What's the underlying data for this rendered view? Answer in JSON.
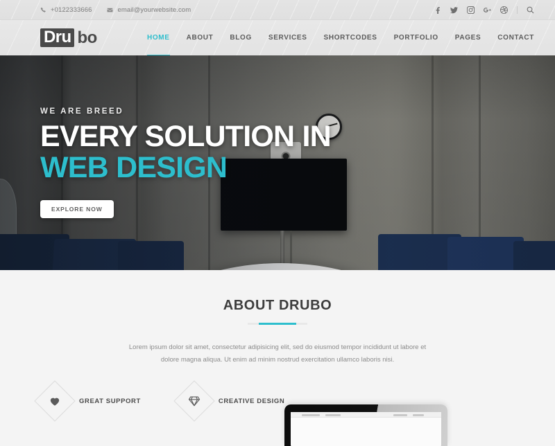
{
  "topbar": {
    "phone": "+0122333666",
    "email": "email@yourwebsite.com",
    "phone_icon": "phone-icon",
    "email_icon": "envelope-icon",
    "social": [
      {
        "name": "facebook-icon",
        "label": "Facebook"
      },
      {
        "name": "twitter-icon",
        "label": "Twitter"
      },
      {
        "name": "instagram-icon",
        "label": "Instagram"
      },
      {
        "name": "google-plus-icon",
        "label": "Google Plus"
      },
      {
        "name": "dribbble-icon",
        "label": "Dribbble"
      }
    ],
    "search_icon": "search-icon"
  },
  "header": {
    "logo_boxed": "Dru",
    "logo_rest": "bo",
    "nav": [
      {
        "label": "HOME",
        "active": true
      },
      {
        "label": "ABOUT",
        "active": false
      },
      {
        "label": "BLOG",
        "active": false
      },
      {
        "label": "SERVICES",
        "active": false
      },
      {
        "label": "SHORTCODES",
        "active": false
      },
      {
        "label": "PORTFOLIO",
        "active": false
      },
      {
        "label": "PAGES",
        "active": false
      },
      {
        "label": "CONTACT",
        "active": false
      }
    ]
  },
  "hero": {
    "eyebrow": "WE ARE BREED",
    "headline_line1": "EVERY SOLUTION IN",
    "headline_line2": "WEB DESIGN",
    "cta_label": "EXPLORE NOW",
    "scene": "conference-room-photo"
  },
  "about": {
    "title": "ABOUT DRUBO",
    "paragraph": "Lorem ipsum dolor sit amet, consectetur adipisicing elit, sed do eiusmod tempor incididunt ut labore et dolore magna aliqua. Ut enim ad minim nostrud exercitation ullamco laboris nisi."
  },
  "features": [
    {
      "label": "GREAT SUPPORT",
      "icon": "heart-icon"
    },
    {
      "label": "CREATIVE DESIGN",
      "icon": "gem-icon"
    }
  ],
  "colors": {
    "accent": "#2dbecd",
    "topbar_bg": "#e2e2e2",
    "header_bg": "#e6e6e6",
    "section_bg": "#f4f4f4",
    "logo_box": "#4a4a4a",
    "heading": "#3d3d3d",
    "body_text": "#8b8b8b",
    "chair_navy": "#1e3354"
  }
}
